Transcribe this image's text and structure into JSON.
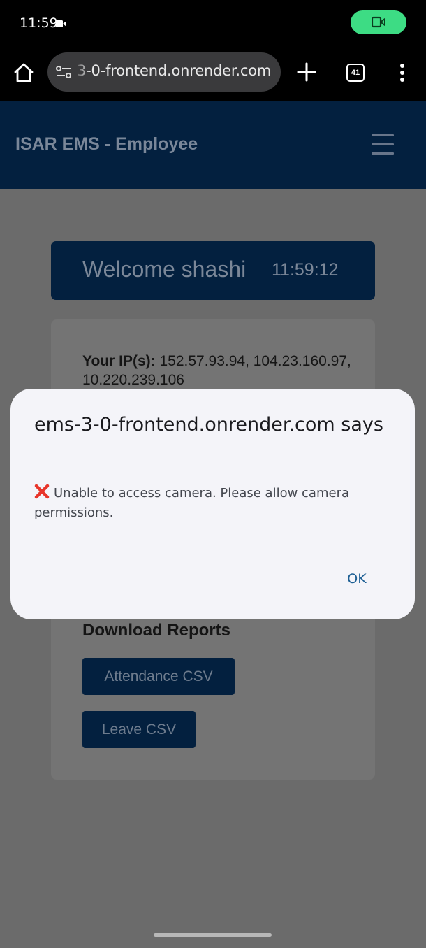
{
  "status_bar": {
    "time": "11:59",
    "accent_color": "#3ddc84"
  },
  "browser": {
    "url": "3-0-frontend.onrender.com",
    "tab_count": "41",
    "icons": [
      "home-icon",
      "site-settings-icon",
      "plus-icon",
      "tab-switcher-icon",
      "more-vert-icon"
    ]
  },
  "header": {
    "title": "ISAR EMS - Employee",
    "menu_icon": "hamburger-icon",
    "bg_color": "#03203f"
  },
  "welcome": {
    "text": "Welcome shashi",
    "time": "11:59:12"
  },
  "card": {
    "ip_label": "Your IP(s):",
    "ip_values": " 152.57.93.94, 104.23.160.97, 10.220.239.106",
    "downloads_title": "Download Reports",
    "attendance_button": "Attendance CSV",
    "leave_button": "Leave CSV"
  },
  "dialog": {
    "title": "ems-3-0-frontend.onrender.com says",
    "message": "Unable to access camera. Please allow camera permissions.",
    "message_icon": "cross-mark-icon",
    "ok_label": "OK"
  }
}
